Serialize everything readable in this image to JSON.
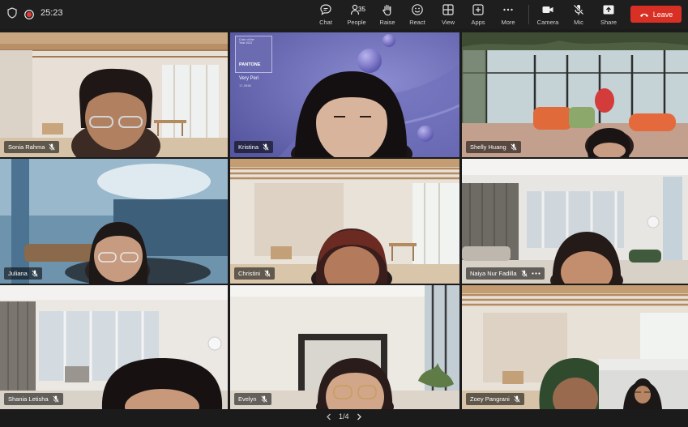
{
  "header": {
    "timer": "25:23",
    "icons": [
      "shield-icon",
      "recording-icon"
    ],
    "toolbar": [
      {
        "name": "chat",
        "label": "Chat",
        "icon": "chat-bubble-icon"
      },
      {
        "name": "people",
        "label": "People",
        "icon": "people-icon",
        "badge": "35"
      },
      {
        "name": "raise",
        "label": "Raise",
        "icon": "hand-icon"
      },
      {
        "name": "react",
        "label": "React",
        "icon": "smiley-icon"
      },
      {
        "name": "view",
        "label": "View",
        "icon": "grid-icon"
      },
      {
        "name": "apps",
        "label": "Apps",
        "icon": "plus-square-icon"
      },
      {
        "name": "more",
        "label": "More",
        "icon": "ellipsis-icon"
      },
      {
        "name": "camera",
        "label": "Camera",
        "icon": "video-camera-icon"
      },
      {
        "name": "mic",
        "label": "Mic",
        "icon": "mic-off-icon"
      },
      {
        "name": "share",
        "label": "Share",
        "icon": "share-up-icon"
      }
    ],
    "leave_label": "Leave",
    "leave_color": "#d93025"
  },
  "pantone": {
    "line1": "Color of the Year 2022",
    "brand": "PANTONE",
    "color_name": "Very Peri",
    "code": "17-3938",
    "color": "#6667ab"
  },
  "participants": [
    {
      "name": "Sonia Rahma",
      "muted": true
    },
    {
      "name": "Kristina",
      "muted": true
    },
    {
      "name": "Shelly Huang",
      "muted": true
    },
    {
      "name": "Juliana",
      "muted": true
    },
    {
      "name": "Christini",
      "muted": true
    },
    {
      "name": "Naiya Nur Fadilla",
      "muted": true,
      "more": true
    },
    {
      "name": "Shania Letisha",
      "muted": true
    },
    {
      "name": "Evelyn",
      "muted": true
    },
    {
      "name": "Zoey Pangrani",
      "muted": true
    }
  ],
  "pagination": {
    "label": "1/4"
  }
}
